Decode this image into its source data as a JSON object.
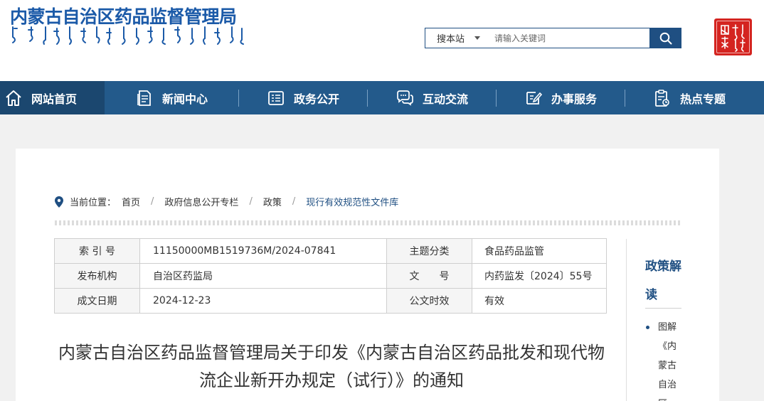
{
  "header": {
    "site_title": "内蒙古自治区药品监督管理局",
    "mongolian_title_logo": "Mongolian-script site title",
    "seal_logo": "seal",
    "search": {
      "scope_label": "搜本站",
      "placeholder": "请输入关键词",
      "button_icon": "search-icon"
    }
  },
  "nav": {
    "items": [
      {
        "label": "网站首页",
        "icon": "home-icon"
      },
      {
        "label": "新闻中心",
        "icon": "document-icon"
      },
      {
        "label": "政务公开",
        "icon": "list-icon"
      },
      {
        "label": "互动交流",
        "icon": "chat-icon"
      },
      {
        "label": "办事服务",
        "icon": "edit-icon"
      },
      {
        "label": "热点专题",
        "icon": "clipboard-icon"
      }
    ]
  },
  "breadcrumb": {
    "prefix": "当前位置：",
    "items": [
      "首页",
      "政府信息公开专栏",
      "政策",
      "现行有效规范性文件库"
    ]
  },
  "meta": {
    "rows": [
      {
        "k1": "索 引 号",
        "v1": "11150000MB1519736M/2024-07841",
        "k2": "主题分类",
        "v2": "食品药品监管"
      },
      {
        "k1": "发布机构",
        "v1": "自治区药监局",
        "k2": "文　　号",
        "v2": "内药监发〔2024〕55号"
      },
      {
        "k1": "成文日期",
        "v1": "2024-12-23",
        "k2": "公文时效",
        "v2": "有效"
      }
    ]
  },
  "article": {
    "title": "内蒙古自治区药品监督管理局关于印发《内蒙古自治区药品批发和现代物流企业新开办规定（试行）》的通知"
  },
  "sidebar": {
    "heading": "政策解读",
    "items": [
      {
        "label": "图解《内蒙古自治区"
      }
    ]
  },
  "colors": {
    "brand": "#1f4f82",
    "nav_bg": "#235a8b",
    "nav_active": "#1b476f",
    "seal": "#d42420"
  }
}
